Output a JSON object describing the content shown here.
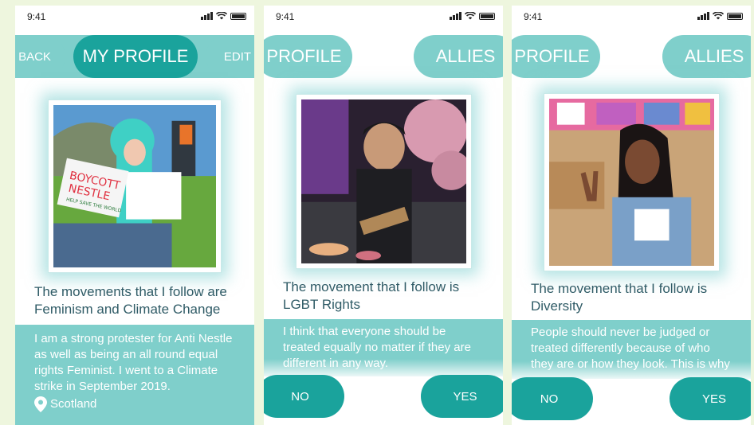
{
  "status": {
    "time": "9:41"
  },
  "screen1": {
    "back_label": "BACK",
    "title": "MY PROFILE",
    "edit_label": "EDIT",
    "photo_sign": [
      "BOYCOTT",
      "NESTLE"
    ],
    "photo_sign_sub": "HELP SAVE THE WORLD",
    "movement_line1": "The movements that I follow are",
    "movement_line2": "Feminism and Climate Change",
    "bio_lines": [
      "I am a strong protester for Anti Nestle",
      "as well as being an all round equal",
      "rights Feminist. I went to a Climate",
      "strike in September 2019."
    ],
    "location": "Scotland"
  },
  "screen2": {
    "profile_label": "PROFILE",
    "allies_label": "ALLIES",
    "movement_line1": "The movement that I follow is",
    "movement_line2": "LGBT Rights",
    "bio_lines": [
      "I think that everyone should be",
      "treated equally no matter if they are",
      "different in any way."
    ],
    "no_label": "NO",
    "yes_label": "YES"
  },
  "screen3": {
    "profile_label": "PROFILE",
    "allies_label": "ALLIES",
    "movement_line1": "The movement that I follow is",
    "movement_line2": "Diversity",
    "bio_lines": [
      "People should never be judged or",
      "treated differently because of who",
      "they are or how they look. This is why"
    ],
    "no_label": "NO",
    "yes_label": "YES"
  },
  "colors": {
    "teal_light": "#7fcfcb",
    "teal_dark": "#1aa39c",
    "text_dark": "#2f5b66",
    "background": "#eef6de"
  }
}
